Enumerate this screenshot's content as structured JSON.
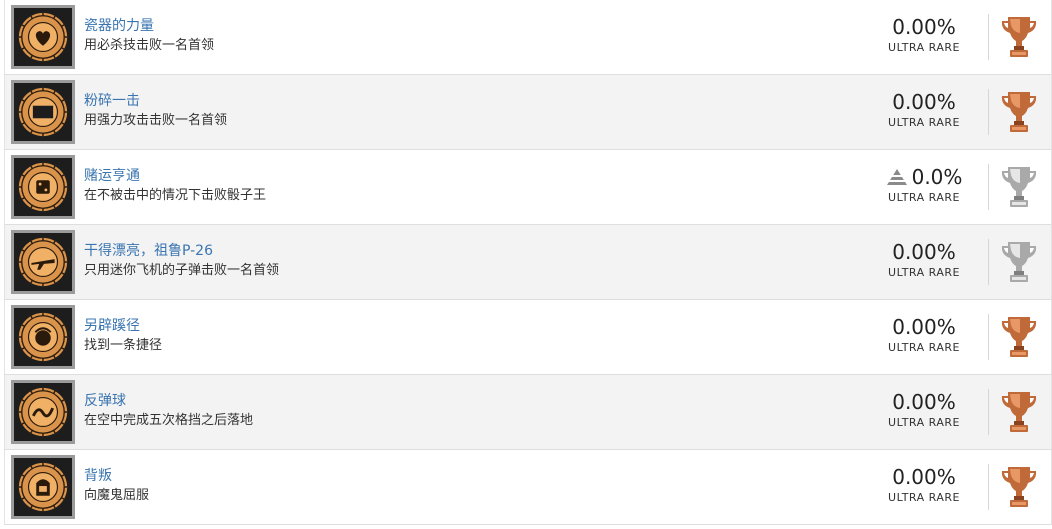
{
  "colors": {
    "title": "#3a75b0",
    "bronze": "#c06a3a",
    "silver": "#bdbdbd",
    "badge_bg": "#1d1d1d",
    "badge_gold": "#d9934a"
  },
  "trophies": [
    {
      "title": "瓷器的力量",
      "description": "用必杀技击败一名首领",
      "percent": "0.00%",
      "rarity": "ULTRA RARE",
      "trend": false,
      "tier": "bronze",
      "icon": "heart-coin-icon"
    },
    {
      "title": "粉碎一击",
      "description": "用强力攻击击败一名首领",
      "percent": "0.00%",
      "rarity": "ULTRA RARE",
      "trend": false,
      "tier": "bronze",
      "icon": "ex-coin-icon"
    },
    {
      "title": "赌运亨通",
      "description": "在不被击中的情况下击败骰子王",
      "percent": "0.0%",
      "rarity": "ULTRA RARE",
      "trend": true,
      "tier": "silver",
      "icon": "dice-coin-icon"
    },
    {
      "title": "干得漂亮，祖鲁P-26",
      "description": "只用迷你飞机的子弹击败一名首领",
      "percent": "0.00%",
      "rarity": "ULTRA RARE",
      "trend": false,
      "tier": "silver",
      "icon": "plane-coin-icon"
    },
    {
      "title": "另辟蹊径",
      "description": "找到一条捷径",
      "percent": "0.00%",
      "rarity": "ULTRA RARE",
      "trend": false,
      "tier": "bronze",
      "icon": "shortcut-coin-icon"
    },
    {
      "title": "反弹球",
      "description": "在空中完成五次格挡之后落地",
      "percent": "0.00%",
      "rarity": "ULTRA RARE",
      "trend": false,
      "tier": "bronze",
      "icon": "parry-coin-icon"
    },
    {
      "title": "背叛",
      "description": "向魔鬼屈服",
      "percent": "0.00%",
      "rarity": "ULTRA RARE",
      "trend": false,
      "tier": "bronze",
      "icon": "throne-coin-icon"
    }
  ]
}
